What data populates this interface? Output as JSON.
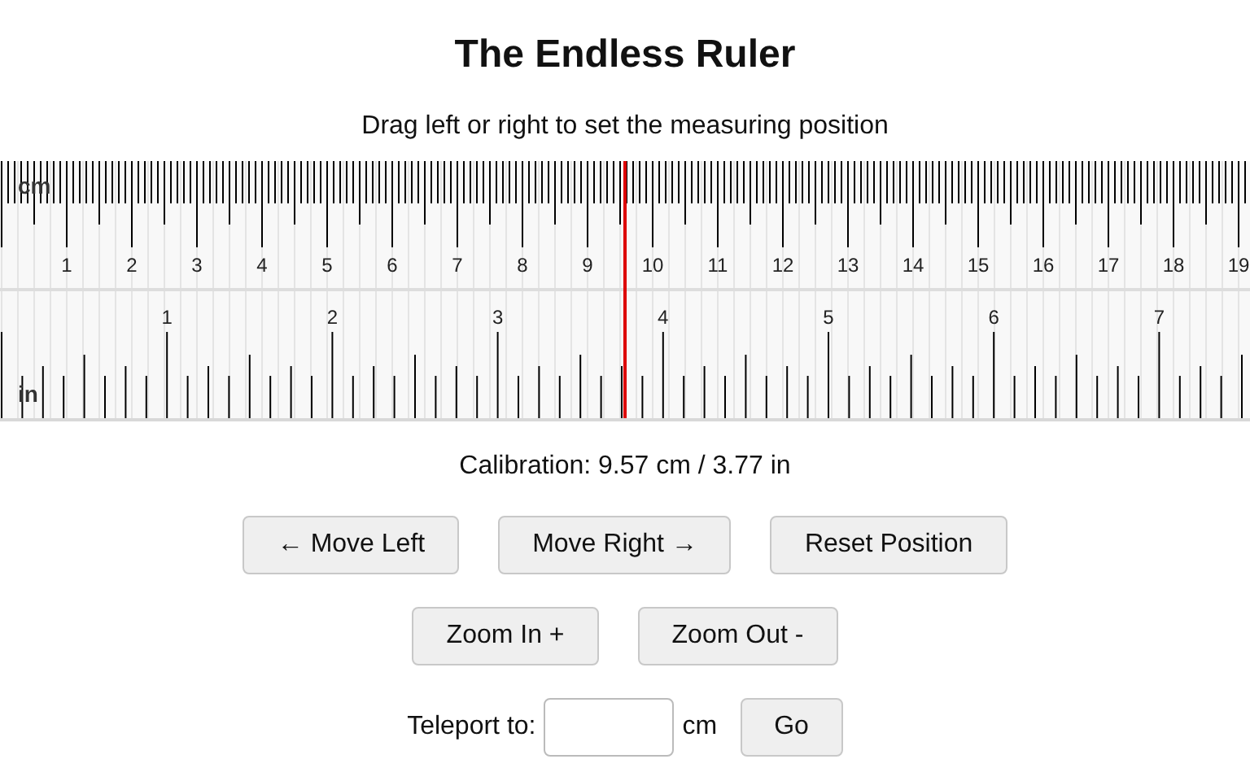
{
  "title": "The Endless Ruler",
  "subtitle": "Drag left or right to set the measuring position",
  "ruler": {
    "cm_unit": "cm",
    "in_unit": "in",
    "cm_labels": [
      "1",
      "2",
      "3",
      "4",
      "5",
      "6",
      "7",
      "8",
      "9",
      "10",
      "11",
      "12",
      "13",
      "14",
      "15",
      "16",
      "17",
      "18",
      "19"
    ],
    "in_labels": [
      "1",
      "2",
      "3",
      "4",
      "5",
      "6",
      "7"
    ],
    "marker": {
      "level": 0.5
    }
  },
  "calibration": "Calibration: 9.57 cm / 3.77 in",
  "button_rows": [
    [
      "← Move Left",
      "Move Right →",
      "Reset Position"
    ],
    [
      "Zoom In +",
      "Zoom Out -"
    ]
  ],
  "teleport": {
    "label": "Teleport to:",
    "unit": "cm",
    "button": "Go"
  }
}
